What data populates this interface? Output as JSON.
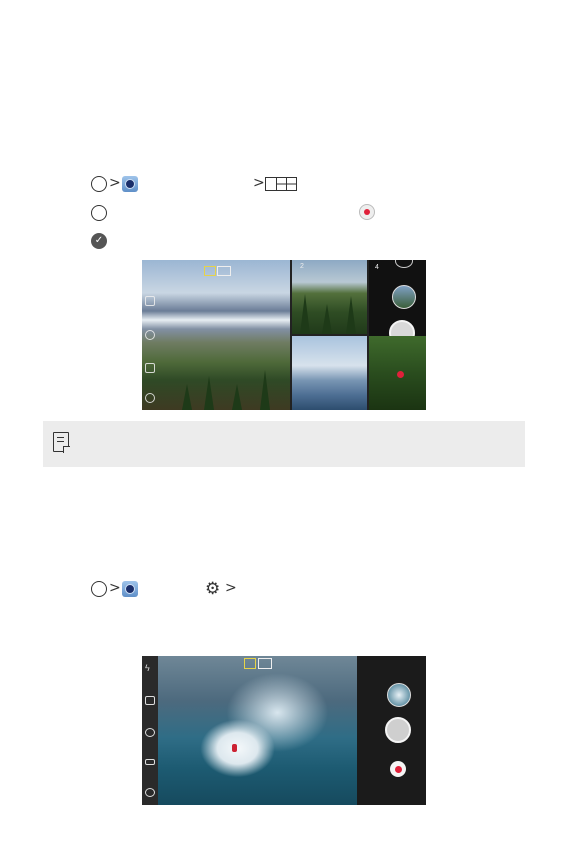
{
  "instructions_1": {
    "step1": {
      "circle_icon": "home-button-icon",
      "app_icon": "camera-app-icon",
      "mode_icon": "grid-mode-icon"
    },
    "step2": {
      "icon": "shutter-icon",
      "record_icon": "record-icon"
    },
    "step3": {
      "icon": "check-icon"
    }
  },
  "screenshot_1": {
    "numbers": [
      "2",
      "4"
    ]
  },
  "note": {
    "icon": "note-icon"
  },
  "instructions_2": {
    "step1": {
      "circle_icon": "home-button-icon",
      "app_icon": "camera-app-icon",
      "settings_icon": "gear-icon"
    }
  },
  "screenshot_2": {},
  "colors": {
    "record_red": "#e0203a",
    "note_background": "#ececec"
  }
}
